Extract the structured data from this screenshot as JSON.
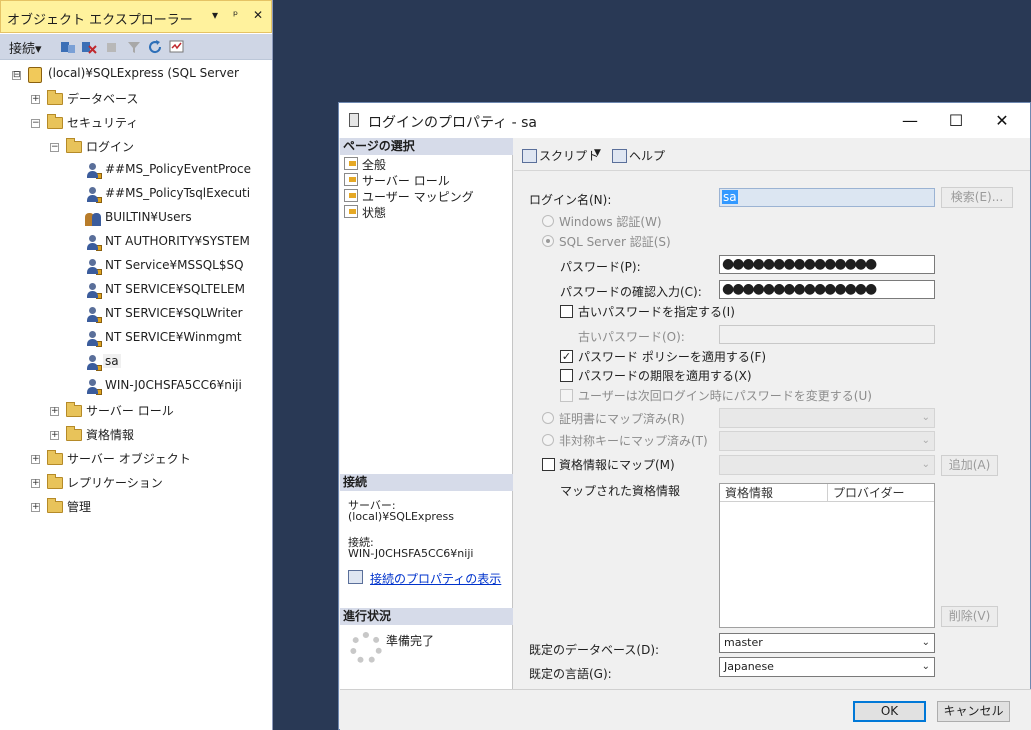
{
  "object_explorer": {
    "title": "オブジェクト エクスプローラー",
    "title_buttons": [
      "▾",
      "ᵖ",
      "✕"
    ],
    "connect_label": "接続▾",
    "tree": [
      {
        "label": "(local)¥SQLExpress (SQL Server",
        "expander": "⊟",
        "icon": "server-icon"
      },
      {
        "label": "データベース",
        "expander": "+",
        "icon": "folder-icon"
      },
      {
        "label": "セキュリティ",
        "expander": "−",
        "icon": "folder-icon"
      },
      {
        "label": "ログイン",
        "expander": "−",
        "icon": "folder-icon"
      },
      {
        "label": "##MS_PolicyEventProce",
        "icon": "login-user-icon"
      },
      {
        "label": "##MS_PolicyTsqlExecuti",
        "icon": "login-user-icon"
      },
      {
        "label": "BUILTIN¥Users",
        "icon": "login-group-icon"
      },
      {
        "label": "NT AUTHORITY¥SYSTEM",
        "icon": "login-user-icon"
      },
      {
        "label": "NT Service¥MSSQL$SQ",
        "icon": "login-user-icon"
      },
      {
        "label": "NT SERVICE¥SQLTELEM",
        "icon": "login-user-icon"
      },
      {
        "label": "NT SERVICE¥SQLWriter",
        "icon": "login-user-icon"
      },
      {
        "label": "NT SERVICE¥Winmgmt",
        "icon": "login-user-icon"
      },
      {
        "label": "sa",
        "icon": "login-user-icon",
        "selected": true
      },
      {
        "label": "WIN-J0CHSFA5CC6¥niji",
        "icon": "login-user-icon"
      },
      {
        "label": "サーバー ロール",
        "expander": "+",
        "icon": "folder-icon"
      },
      {
        "label": "資格情報",
        "expander": "+",
        "icon": "folder-icon"
      },
      {
        "label": "サーバー オブジェクト",
        "expander": "+",
        "icon": "folder-icon"
      },
      {
        "label": "レプリケーション",
        "expander": "+",
        "icon": "folder-icon"
      },
      {
        "label": "管理",
        "expander": "+",
        "icon": "folder-icon"
      }
    ]
  },
  "dialog": {
    "title": "ログインのプロパティ - sa",
    "window_buttons": {
      "minimize": "—",
      "maximize": "☐",
      "close": "✕"
    },
    "left": {
      "page_select_header": "ページの選択",
      "pages": [
        "全般",
        "サーバー ロール",
        "ユーザー マッピング",
        "状態"
      ],
      "connection_header": "接続",
      "server_label": "サーバー:",
      "server_value": "(local)¥SQLExpress",
      "connection_label": "接続:",
      "connection_value": "WIN-J0CHSFA5CC6¥niji",
      "view_connection_link": "接続のプロパティの表示",
      "progress_header": "進行状況",
      "progress_status": "準備完了"
    },
    "toolbar": {
      "script": "スクリプト",
      "script_arrow": "▼",
      "help": "ヘルプ"
    },
    "general": {
      "login_name_label": "ログイン名(N):",
      "login_name_value": "sa",
      "search_button": "検索(E)...",
      "windows_auth": "Windows 認証(W)",
      "sql_auth": "SQL Server 認証(S)",
      "password_label": "パスワード(P):",
      "password_value": "●●●●●●●●●●●●●●●",
      "confirm_password_label": "パスワードの確認入力(C):",
      "confirm_password_value": "●●●●●●●●●●●●●●●",
      "specify_old_password": "古いパスワードを指定する(I)",
      "old_password_label": "古いパスワード(O):",
      "enforce_policy": "パスワード ポリシーを適用する(F)",
      "enforce_expiration": "パスワードの期限を適用する(X)",
      "must_change": "ユーザーは次回ログイン時にパスワードを変更する(U)",
      "map_certificate": "証明書にマップ済み(R)",
      "map_asym_key": "非対称キーにマップ済み(T)",
      "map_credential": "資格情報にマップ(M)",
      "add_button": "追加(A)",
      "mapped_credentials_label": "マップされた資格情報",
      "grid_headers": [
        "資格情報",
        "プロバイダー"
      ],
      "remove_button": "削除(V)",
      "default_db_label": "既定のデータベース(D):",
      "default_db_value": "master",
      "default_lang_label": "既定の言語(G):",
      "default_lang_value": "Japanese",
      "dropdown_arrow": "⌄",
      "check_mark": "✓"
    },
    "footer": {
      "ok": "OK",
      "cancel": "キャンセル"
    }
  },
  "colors": {
    "background": "#293955",
    "oe_title": "#fff29d",
    "accent": "#0078d7",
    "header_band": "#d6dbe9"
  }
}
